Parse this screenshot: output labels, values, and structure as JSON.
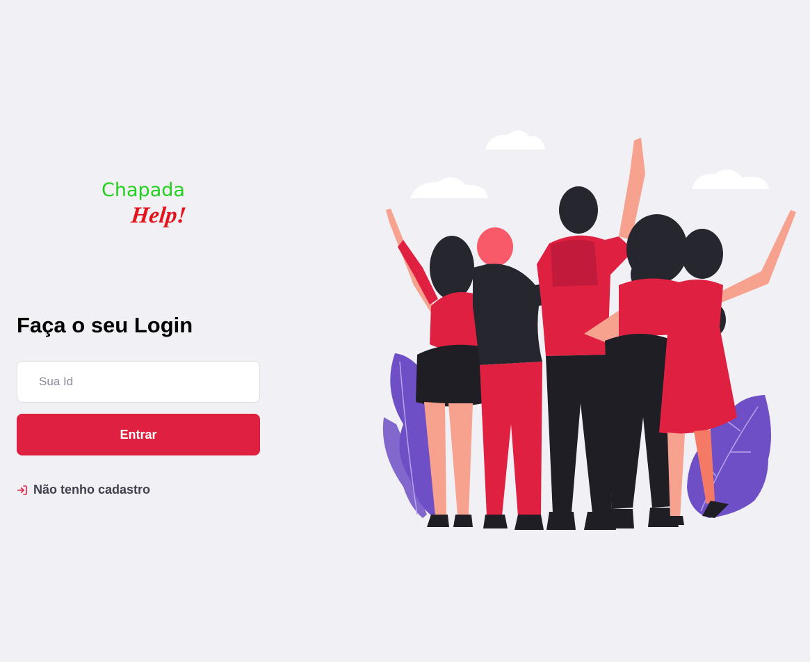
{
  "logo": {
    "line1": "Chapada",
    "line2": "Help!",
    "line1_color": "#22D11B",
    "line2_color": "#E3131B"
  },
  "login": {
    "title": "Faça o seu Login",
    "id_placeholder": "Sua Id",
    "id_value": "",
    "submit_label": "Entrar",
    "register_label": "Não tenho cadastro",
    "register_icon": "log-in-icon"
  },
  "illustration": {
    "name": "group-of-friends-illustration"
  },
  "colors": {
    "background": "#F0F0F5",
    "accent": "#E02041",
    "text": "#41414D",
    "title": "#000000"
  }
}
